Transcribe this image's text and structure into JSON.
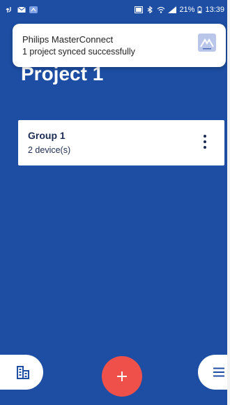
{
  "status_bar": {
    "battery_percent": "21%",
    "time": "13:39",
    "left_icons": [
      "usb-icon",
      "mail-icon",
      "app-notification-icon"
    ],
    "right_icons": [
      "cast-icon",
      "bluetooth-icon",
      "wifi-icon",
      "signal-icon",
      "battery-icon"
    ]
  },
  "notification": {
    "app_name": "Philips MasterConnect",
    "message": "1 project synced successfully",
    "icon": "masterconnect-app-icon"
  },
  "page": {
    "title": "Project 1"
  },
  "groups": [
    {
      "name": "Group 1",
      "subtitle": "2 device(s)"
    }
  ],
  "bottom_bar": {
    "left_icon": "buildings-icon",
    "center_icon": "plus-icon",
    "right_icon": "menu-icon"
  },
  "colors": {
    "background": "#1d4ea3",
    "card": "#ffffff",
    "card_text": "#1b2b52",
    "fab": "#f0504a"
  }
}
